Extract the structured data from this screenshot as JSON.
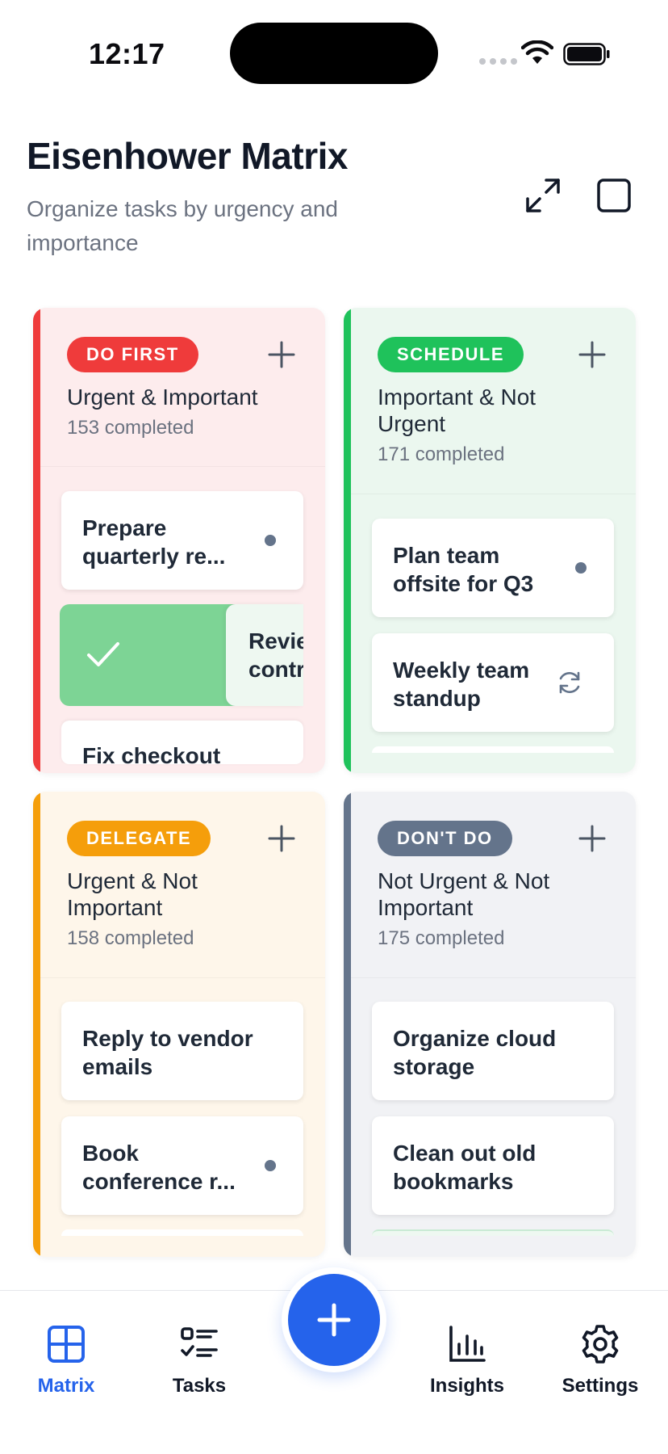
{
  "status_bar": {
    "time": "12:17"
  },
  "header": {
    "title": "Eisenhower Matrix",
    "subtitle": "Organize tasks by urgency and importance"
  },
  "quadrants": {
    "do_first": {
      "badge": "DO FIRST",
      "title": "Urgent & Important",
      "count": "153 completed",
      "accent": "#ef3b3b",
      "tasks": [
        "Prepare quarterly re...",
        "Review contr",
        "Fix checkout"
      ]
    },
    "schedule": {
      "badge": "SCHEDULE",
      "title": "Important & Not Urgent",
      "count": "171 completed",
      "accent": "#1fc25b",
      "tasks": [
        "Plan team offsite for Q3",
        "Weekly team standup"
      ]
    },
    "delegate": {
      "badge": "DELEGATE",
      "title": "Urgent & Not Important",
      "count": "158 completed",
      "accent": "#f59e0b",
      "tasks": [
        "Reply to vendor emails",
        "Book conference r..."
      ]
    },
    "dont_do": {
      "badge": "DON'T DO",
      "title": "Not Urgent & Not Important",
      "count": "175 completed",
      "accent": "#64748b",
      "tasks": [
        "Organize cloud storage",
        "Clean out old bookmarks"
      ]
    }
  },
  "nav": {
    "matrix": "Matrix",
    "tasks": "Tasks",
    "insights": "Insights",
    "settings": "Settings"
  },
  "colors": {
    "primary": "#2563eb"
  }
}
